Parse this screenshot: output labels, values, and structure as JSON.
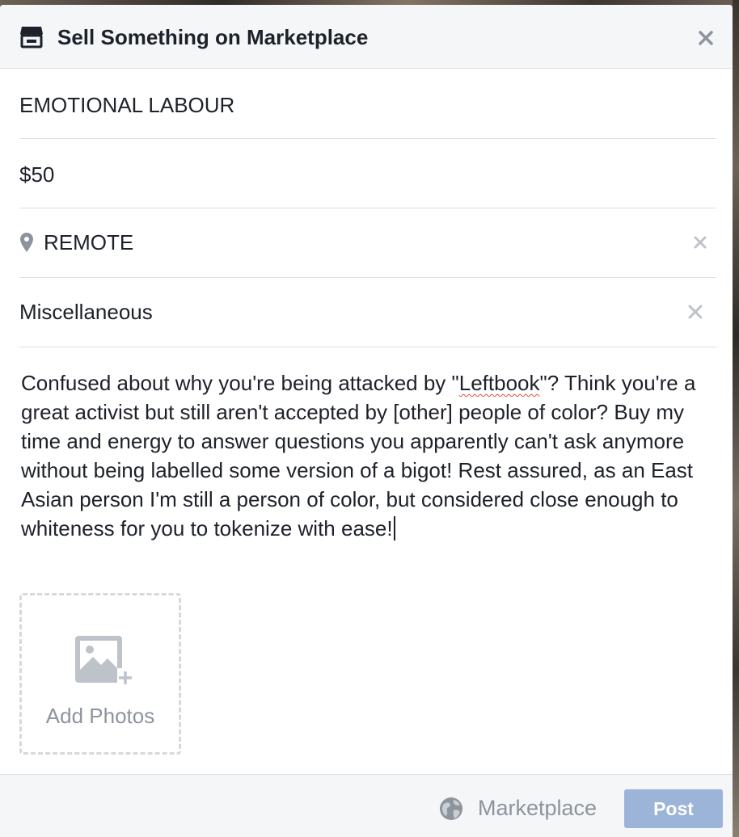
{
  "dialog": {
    "title": "Sell Something on Marketplace",
    "close_icon": "close-icon",
    "header_icon": "shop-icon"
  },
  "form": {
    "title_value": "EMOTIONAL LABOUR",
    "price_value": "$50",
    "location_value": "REMOTE",
    "category_value": "Miscellaneous",
    "description_parts": [
      "Confused about why you're being attacked by \"",
      "Leftbook",
      "\"? Think you're a great activist but still aren't accepted by [other] people of color? Buy my time and energy to answer questions you apparently can't ask anymore without being labelled some version of a bigot! Rest assured, as an East Asian person I'm still a person of color, but considered close enough to whiteness for you to tokenize with ease!"
    ]
  },
  "photos": {
    "label": "Add Photos",
    "icon": "add-photo-icon"
  },
  "footer": {
    "audience_label": "Marketplace",
    "audience_icon": "globe-icon",
    "post_label": "Post"
  },
  "colors": {
    "header_bg": "#f5f6f7",
    "post_button_disabled": "#9cb4d8",
    "muted_text": "#8d949e",
    "body_text": "#1d2129"
  }
}
